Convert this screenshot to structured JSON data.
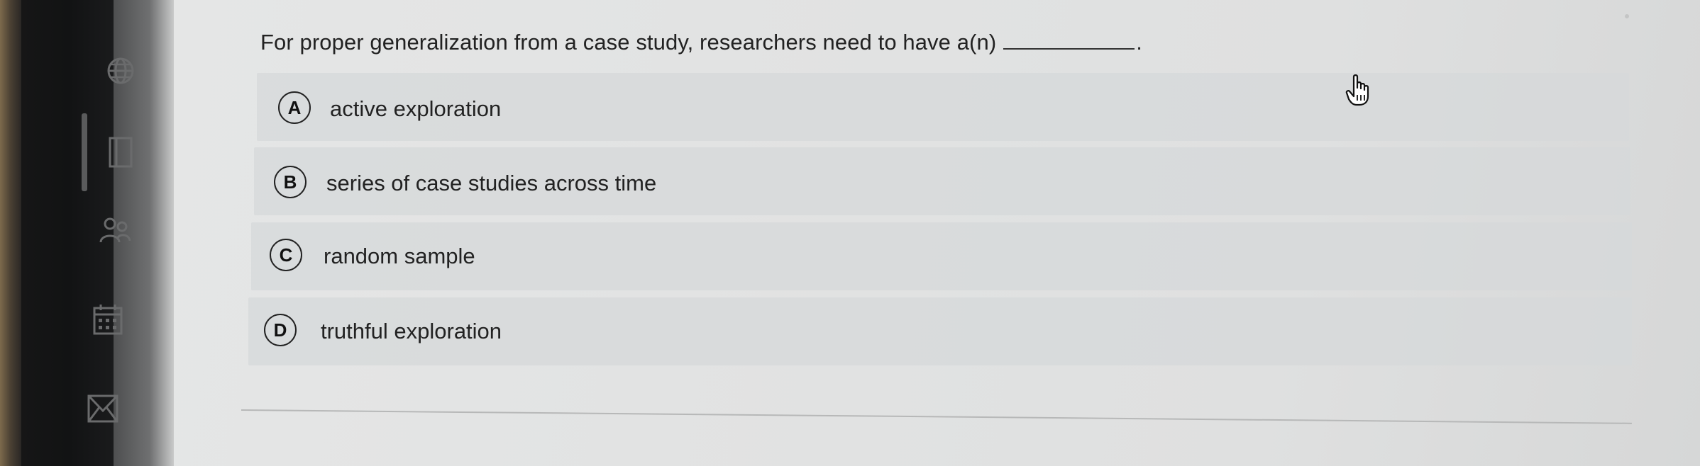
{
  "question": {
    "text": "For proper generalization from a case study, researchers need to have a(n)",
    "terminal": "."
  },
  "options": [
    {
      "letter": "A",
      "text": "active exploration"
    },
    {
      "letter": "B",
      "text": "series of case studies across time"
    },
    {
      "letter": "C",
      "text": "random sample"
    },
    {
      "letter": "D",
      "text": "truthful exploration"
    }
  ],
  "sidebar": {
    "icons": [
      "globe-icon",
      "book-icon",
      "people-icon",
      "calendar-icon",
      "mail-icon"
    ]
  },
  "cursor": {
    "icon": "hand-pointer-icon"
  },
  "colors": {
    "background": "#e2e3e3",
    "option_bg": "#d6d8d9",
    "text": "#222222",
    "sidebar": "#141516"
  }
}
